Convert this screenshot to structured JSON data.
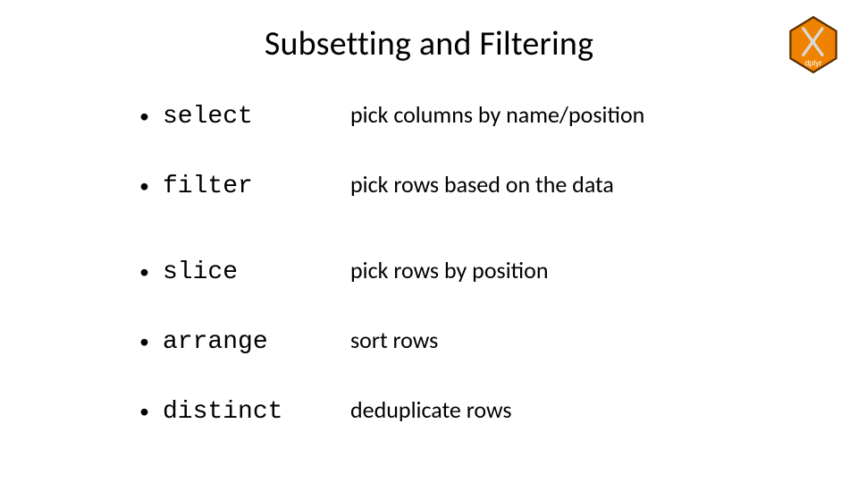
{
  "title": "Subsetting and Filtering",
  "logo": {
    "label": "dplyr",
    "name": "dplyr-hex-logo"
  },
  "items": [
    {
      "fn": "select",
      "desc": "pick columns by name/position"
    },
    {
      "fn": "filter",
      "desc": "pick rows based on the data"
    },
    {
      "fn": "slice",
      "desc": "pick rows by position"
    },
    {
      "fn": "arrange",
      "desc": "sort rows"
    },
    {
      "fn": "distinct",
      "desc": "deduplicate rows"
    }
  ],
  "colors": {
    "hex_fill": "#ef8200",
    "hex_stroke": "#5a2f00",
    "pliers": "#d0d0d0"
  }
}
